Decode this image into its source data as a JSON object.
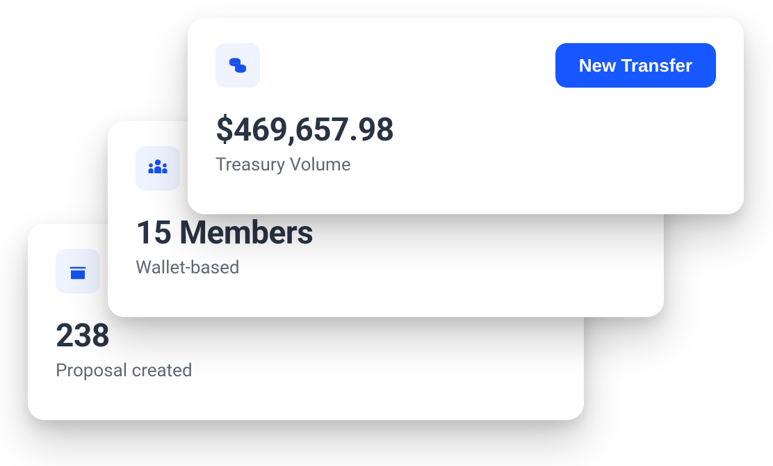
{
  "cards": {
    "treasury": {
      "value": "$469,657.98",
      "label": "Treasury Volume",
      "action_label": "New Transfer"
    },
    "members": {
      "value": "15 Members",
      "label": "Wallet-based"
    },
    "proposals": {
      "value": "238",
      "label": "Proposal created"
    }
  }
}
